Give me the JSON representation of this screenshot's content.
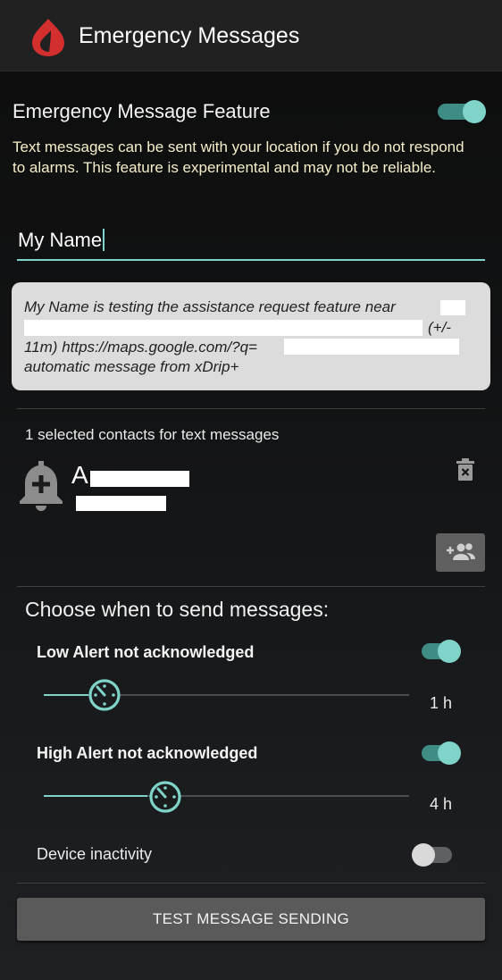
{
  "appbar": {
    "title": "Emergency Messages",
    "logo_icon": "blood-drop-logo-icon",
    "logo_color": "#d32f2f"
  },
  "feature": {
    "title": "Emergency Message Feature",
    "enabled": true,
    "description": "Text messages can be sent with your location if you do not respond to alarms. This feature is experimental and may not be reliable."
  },
  "name_field": {
    "value": "My Name"
  },
  "preview": {
    "line1": "My Name is testing the assistance request feature near",
    "line2": "(+/-",
    "line3": "11m) https://maps.google.com/?q=",
    "line4": "automatic message from xDrip+"
  },
  "contacts": {
    "count_text": "1 selected contacts for text messages",
    "items": [
      {
        "name_initial": "A",
        "avatar_icon": "add-alert-bell-icon"
      }
    ],
    "delete_icon": "trash-icon",
    "add_icon": "add-group-icon"
  },
  "triggers": {
    "title": "Choose when to send messages:",
    "low_alert": {
      "label": "Low Alert not acknowledged",
      "enabled": true,
      "value_text": "1 h",
      "slider_fraction": 0.19
    },
    "high_alert": {
      "label": "High Alert not acknowledged",
      "enabled": true,
      "value_text": "4 h",
      "slider_fraction": 0.33
    },
    "device_inactivity": {
      "label": "Device inactivity",
      "enabled": false
    }
  },
  "test_button": {
    "label": "TEST MESSAGE SENDING"
  },
  "colors": {
    "accent": "#7fd3c8",
    "description_text": "#f5eec8",
    "preview_bg": "#dcdcdc"
  }
}
